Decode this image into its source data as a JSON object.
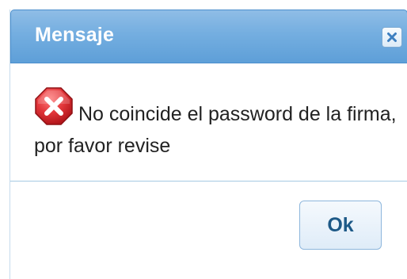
{
  "dialog": {
    "title": "Mensaje",
    "close_icon": "close-icon",
    "error_icon": "error-icon",
    "message": "No coincide el password de la firma, por favor revise",
    "ok_label": "Ok"
  },
  "colors": {
    "titlebar": "#74aee0",
    "title_text": "#ffffff",
    "button_text": "#1d5987",
    "error_red": "#d9262c"
  }
}
